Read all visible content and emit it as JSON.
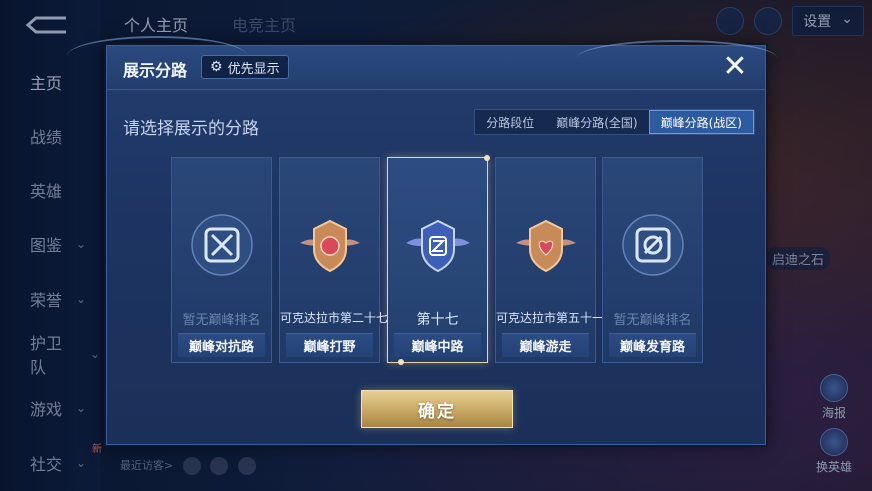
{
  "background": {
    "nav": [
      {
        "label": "主页",
        "chevron": false
      },
      {
        "label": "战绩",
        "chevron": false
      },
      {
        "label": "英雄",
        "chevron": false
      },
      {
        "label": "图鉴",
        "chevron": true
      },
      {
        "label": "荣誉",
        "chevron": true
      },
      {
        "label": "护卫队",
        "chevron": true
      },
      {
        "label": "游戏",
        "chevron": true
      },
      {
        "label": "社交",
        "chevron": true
      }
    ],
    "new_badge": "新",
    "top_tabs": [
      "个人主页",
      "电竞主页"
    ],
    "settings_label": "设置",
    "side_chip": "启迪之石",
    "right_buttons": [
      "海报",
      "换英雄"
    ],
    "recent_visitors": "最近访客>"
  },
  "modal": {
    "title": "展示分路",
    "priority_label": "优先显示",
    "close_icon": "close-icon",
    "subtitle": "请选择展示的分路",
    "segments": [
      {
        "label": "分路段位",
        "active": false
      },
      {
        "label": "巅峰分路(全国)",
        "active": false
      },
      {
        "label": "巅峰分路(战区)",
        "active": true
      }
    ],
    "cards": [
      {
        "lane": "巅峰对抗路",
        "rank": "暂无巅峰排名",
        "has_rank": false,
        "icon": "sword-shield-icon",
        "selected": false
      },
      {
        "lane": "巅峰打野",
        "rank": "可克达拉市第二十七",
        "has_rank": true,
        "icon": "jungle-emblem-icon",
        "selected": false
      },
      {
        "lane": "巅峰中路",
        "rank": "第十七",
        "has_rank": true,
        "icon": "mid-emblem-icon",
        "selected": true
      },
      {
        "lane": "巅峰游走",
        "rank": "可克达拉市第五十一",
        "has_rank": true,
        "icon": "support-emblem-icon",
        "selected": false
      },
      {
        "lane": "巅峰发育路",
        "rank": "暂无巅峰排名",
        "has_rank": false,
        "icon": "marksman-icon",
        "selected": false
      }
    ],
    "confirm_label": "确定"
  },
  "colors": {
    "accent_gold": "#e7cf92",
    "segment_active": "#2d5ba0",
    "modal_bg": "#1d3462"
  }
}
